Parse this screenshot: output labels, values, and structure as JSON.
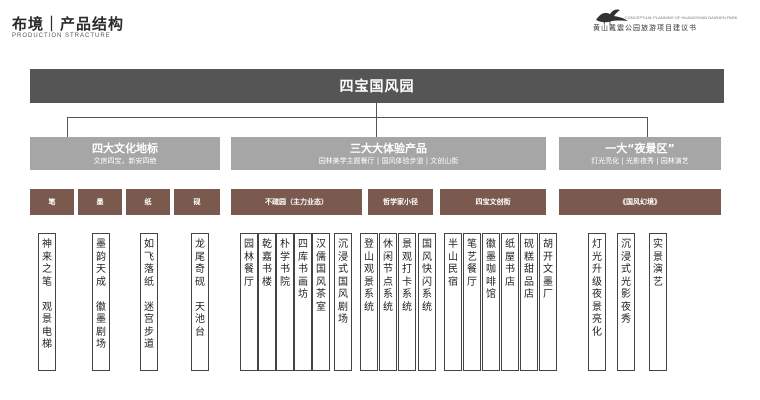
{
  "header": {
    "title": "布境｜产品结构",
    "subtitle": "PRODUCTION STRACTURE",
    "brand_en": "CONCEPTUAL PLANNING OF HUANGSHAN DAIZHEN PARK",
    "brand_cn": "黄山戴震公园旅游项目建议书"
  },
  "root": {
    "label": "四宝国风园"
  },
  "level2": [
    {
      "title": "四大文化地标",
      "subtitle": "文房四宝，新安四绝"
    },
    {
      "title": "三大大体验产品",
      "subtitle": "园林美学主题餐厅 | 国风体验步道 | 文创山街"
    },
    {
      "title": "一大“夜景区”",
      "subtitle": "灯光亮化 | 光影夜秀 | 园林演艺"
    }
  ],
  "level3": [
    {
      "label": "笔"
    },
    {
      "label": "墨"
    },
    {
      "label": "纸"
    },
    {
      "label": "砚"
    },
    {
      "label": "不疏园（主力业态）"
    },
    {
      "label": "哲学家小径"
    },
    {
      "label": "四宝文创街"
    },
    {
      "label": "《国风幻境》"
    }
  ],
  "leaves": [
    {
      "text": "神来之笔 观景电梯"
    },
    {
      "text": "墨韵天成 徽墨剧场"
    },
    {
      "text": "如飞落纸 迷宫步道"
    },
    {
      "text": "龙尾奇砚 天池台"
    },
    {
      "text": "园林餐厅"
    },
    {
      "text": "乾嘉书楼"
    },
    {
      "text": "朴学书院"
    },
    {
      "text": "四库书画坊"
    },
    {
      "text": "汉儒国风茶室"
    },
    {
      "text": "沉浸式国风剧场"
    },
    {
      "text": "登山观景系统"
    },
    {
      "text": "休闲节点系统"
    },
    {
      "text": "景观打卡系统"
    },
    {
      "text": "国风快闪系统"
    },
    {
      "text": "半山民宿"
    },
    {
      "text": "笔艺餐厅"
    },
    {
      "text": "徽墨咖啡馆"
    },
    {
      "text": "纸屋书店"
    },
    {
      "text": "砚糕甜品店"
    },
    {
      "text": "胡开文墨厂"
    },
    {
      "text": "灯光升级夜景亮化"
    },
    {
      "text": "沉浸式光影夜秀"
    },
    {
      "text": "实景演艺"
    }
  ]
}
